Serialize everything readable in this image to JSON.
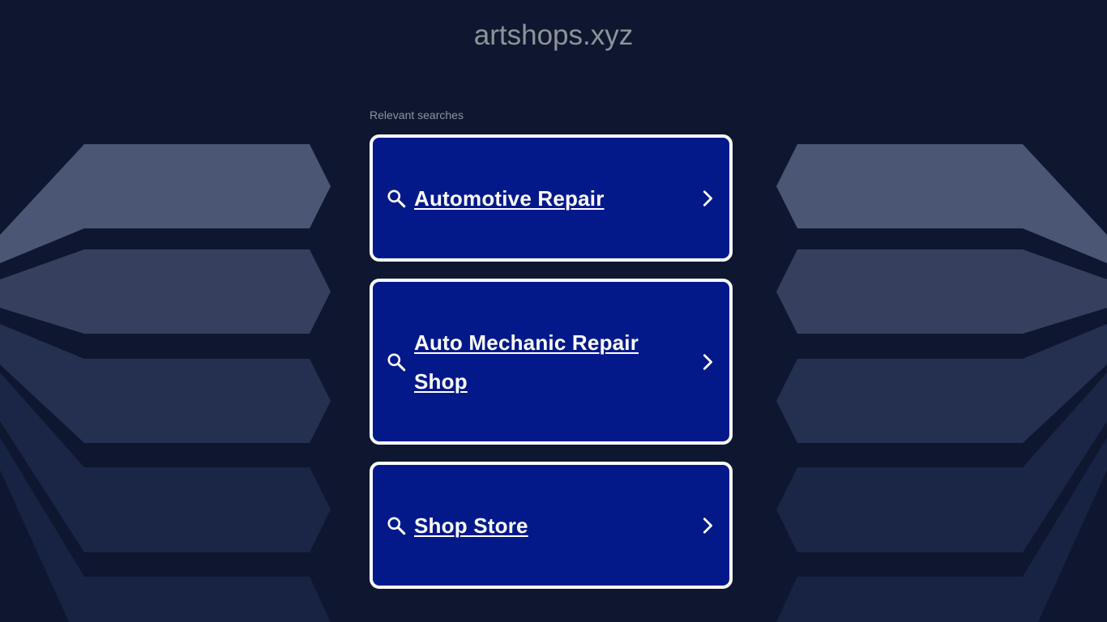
{
  "site": {
    "domain": "artshops.xyz"
  },
  "searches": {
    "heading": "Relevant searches",
    "items": [
      {
        "label": "Automotive Repair"
      },
      {
        "label": "Auto Mechanic Repair Shop"
      },
      {
        "label": "Shop Store"
      }
    ]
  },
  "colors": {
    "background": "#0e172f",
    "card_fill": "#03198a",
    "card_border": "#ffffff",
    "muted_text": "#8f939a"
  },
  "icons": {
    "search": "search-icon",
    "chevron": "chevron-right-icon"
  }
}
